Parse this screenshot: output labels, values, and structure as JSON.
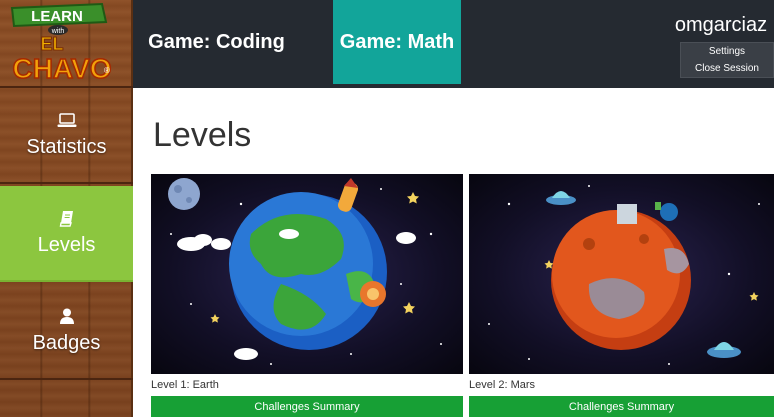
{
  "logo": {
    "line1": "LEARN",
    "line2": "with",
    "line3": "EL",
    "line4": "CHAVO",
    "mark": "®"
  },
  "sidebar": {
    "items": [
      {
        "label": "Statistics",
        "icon": "laptop-icon",
        "active": false
      },
      {
        "label": "Levels",
        "icon": "book-icon",
        "active": true
      },
      {
        "label": "Badges",
        "icon": "person-icon",
        "active": false
      }
    ]
  },
  "header": {
    "tabs": [
      {
        "label": "Game: Coding",
        "active": false
      },
      {
        "label": "Game: Math",
        "active": true
      }
    ],
    "username": "omgarciaz",
    "menu": {
      "settings": "Settings",
      "close_session": "Close Session"
    }
  },
  "main": {
    "title": "Levels",
    "levels": [
      {
        "title": "Level 1: Earth",
        "button": "Challenges Summary",
        "image": "earth-planet"
      },
      {
        "title": "Level 2: Mars",
        "button": "Challenges Summary",
        "image": "mars-planet"
      }
    ]
  },
  "colors": {
    "header_bg": "#252a31",
    "active_tab": "#12a59a",
    "active_sidebar": "#8cc63f",
    "button_green": "#17a035",
    "wood": "#7b4320"
  }
}
